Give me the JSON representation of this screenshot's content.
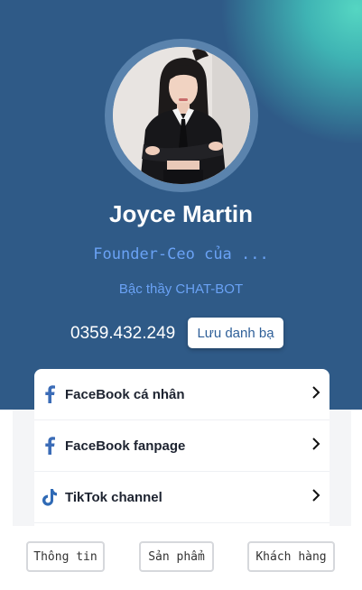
{
  "profile": {
    "name": "Joyce Martin",
    "role": "Founder-Ceo của ...",
    "skill": "Bậc thầy CHAT-BOT",
    "phone": "0359.432.249",
    "save_contact_label": "Lưu danh bạ"
  },
  "links": [
    {
      "label": "FaceBook cá nhân",
      "icon": "facebook-icon"
    },
    {
      "label": "FaceBook fanpage",
      "icon": "facebook-icon"
    },
    {
      "label": "TikTok channel",
      "icon": "tiktok-icon"
    }
  ],
  "tabs": [
    {
      "label": "Thông tin"
    },
    {
      "label": "Sản phẩm"
    },
    {
      "label": "Khách hàng"
    }
  ],
  "colors": {
    "header_bg": "#2f5a87",
    "accent_text": "#6aa2f5",
    "corner_glow": "#55d6c2",
    "facebook": "#3b6cb7",
    "tiktok": "#2f6ab5"
  }
}
